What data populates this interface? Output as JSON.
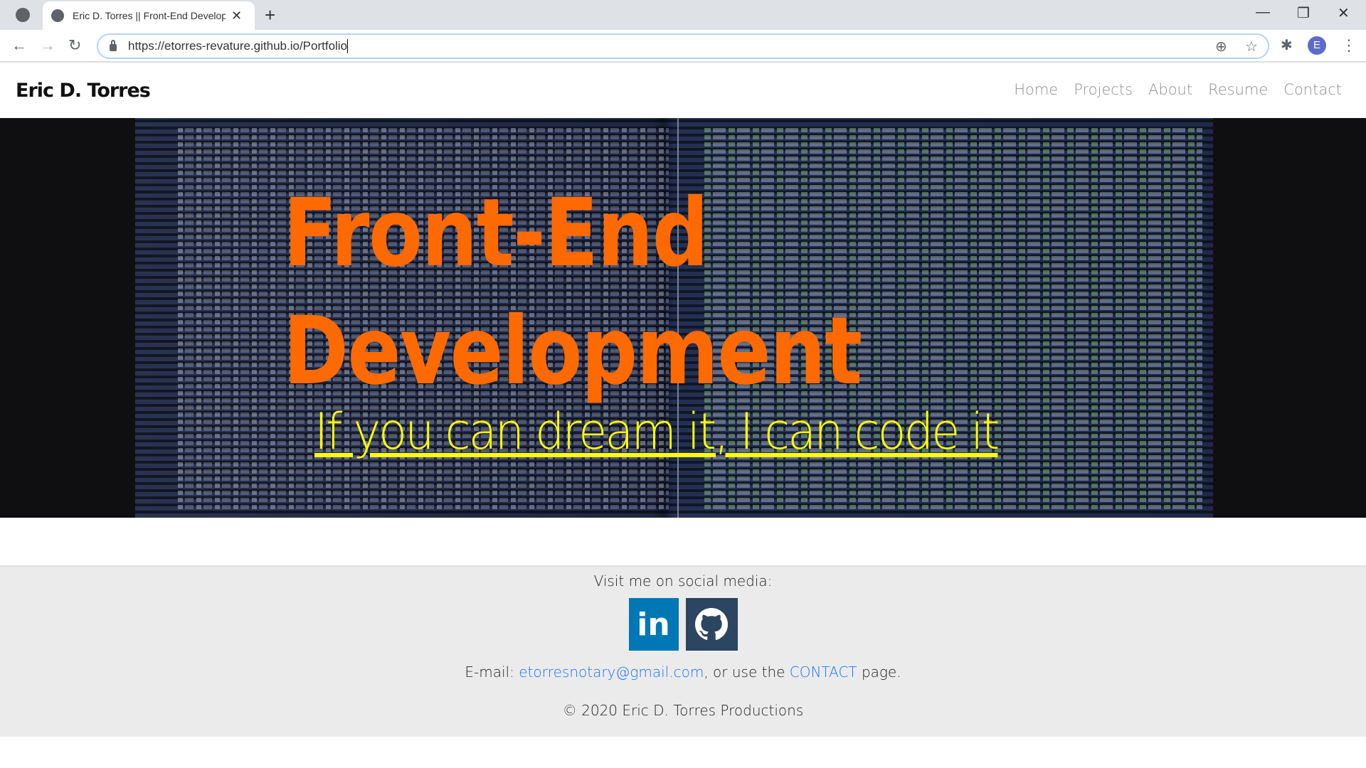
{
  "browser": {
    "tab_title": "Eric D. Torres || Front-End Development",
    "new_tab": "+",
    "url": "https://etorres-revature.github.io/Portfolio",
    "profile_initial": "E",
    "window_controls": {
      "minimize": "—",
      "restore": "❐",
      "close": "✕"
    }
  },
  "header": {
    "brand": "Eric D. Torres",
    "nav": [
      "Home",
      "Projects",
      "About",
      "Resume",
      "Contact"
    ]
  },
  "hero": {
    "title_line1": "Front-End",
    "title_line2": "Development",
    "tagline": "If you can dream it, I can code it",
    "title_color": "#ff6a00",
    "tagline_color": "#ffff00"
  },
  "footer": {
    "social_heading": "Visit me on social media:",
    "linkedin_label": "in",
    "email_prefix": "E-mail: ",
    "email": "etorresnotary@gmail.com",
    "email_mid": ", or use the ",
    "contact_link": "CONTACT",
    "email_suffix": " page.",
    "copyright": "© 2020 Eric D. Torres Productions"
  }
}
